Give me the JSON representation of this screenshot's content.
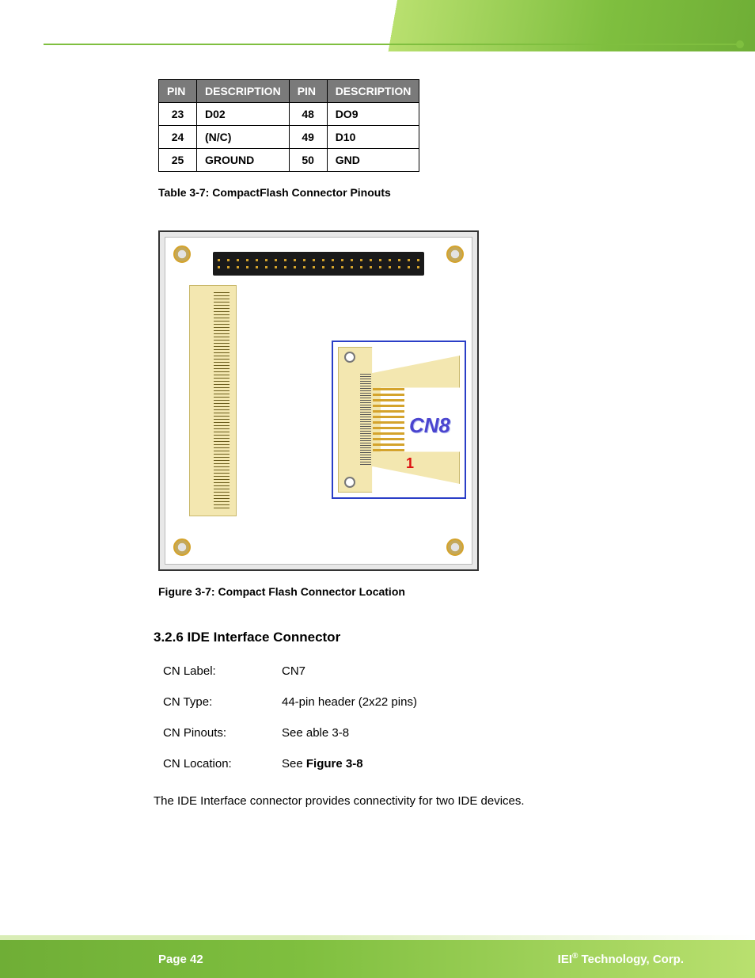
{
  "table": {
    "headers": [
      "PIN",
      "DESCRIPTION",
      "PIN",
      "DESCRIPTION"
    ],
    "rows": [
      {
        "p1": "23",
        "d1": "D02",
        "p2": "48",
        "d2": "DO9"
      },
      {
        "p1": "24",
        "d1": "(N/C)",
        "p2": "49",
        "d2": "D10"
      },
      {
        "p1": "25",
        "d1": "GROUND",
        "p2": "50",
        "d2": "GND"
      }
    ],
    "caption": "Table 3-7: CompactFlash Connector Pinouts"
  },
  "figure": {
    "cn_label": "CN8",
    "pin1": "1",
    "caption": "Figure 3-7: Compact Flash Connector Location"
  },
  "section": {
    "heading": "3.2.6 IDE Interface Connector",
    "rows": {
      "label_label": "CN Label:",
      "label_value": "CN7",
      "type_label": "CN Type:",
      "type_value": "44-pin header (2x22 pins)",
      "pinouts_label": "CN Pinouts:",
      "pinouts_value": "See able 3-8",
      "location_label": "CN Location:",
      "location_value_prefix": "See ",
      "location_value_bold": "Figure 3-8"
    },
    "body": "The IDE Interface connector provides connectivity for two IDE devices."
  },
  "footer": {
    "page": "Page 42",
    "company_prefix": "IEI",
    "company_reg": "®",
    "company_suffix": " Technology, Corp."
  }
}
